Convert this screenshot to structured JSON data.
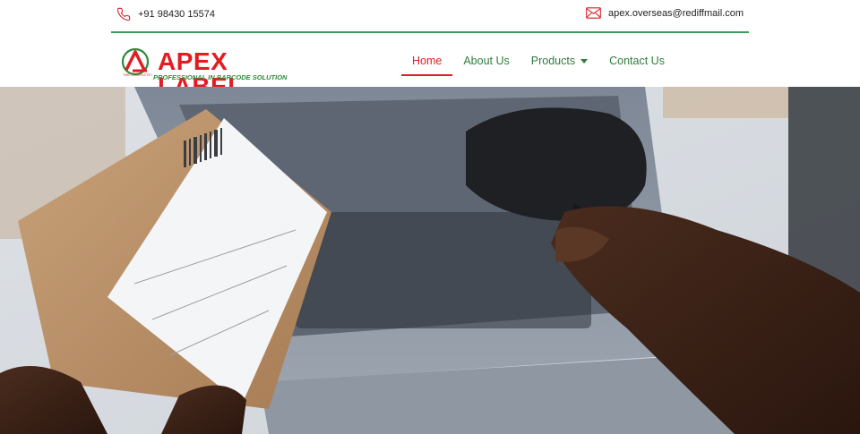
{
  "topbar": {
    "phone_icon": "phone-icon",
    "phone": "+91 98430 15574",
    "email_icon": "mail-icon",
    "email": "apex.overseas@rediffmail.com",
    "divider_color": "#3f9a5f"
  },
  "logo": {
    "wordmark": "APEX LABEL",
    "tagline": "PROFESSIONAL IN BARCODE SOLUTION",
    "brand_red": "#e11d22",
    "brand_green": "#2e8b3a"
  },
  "nav": {
    "items": [
      {
        "label": "Home",
        "active": true
      },
      {
        "label": "About Us",
        "active": false
      },
      {
        "label": "Products",
        "active": false,
        "has_dropdown": true
      },
      {
        "label": "Contact Us",
        "active": false
      }
    ],
    "active_color": "#d81f26",
    "color": "#2e7d3a"
  },
  "hero": {
    "image": "hand holding barcode scanner over a labeled cardboard box near a laptop"
  }
}
